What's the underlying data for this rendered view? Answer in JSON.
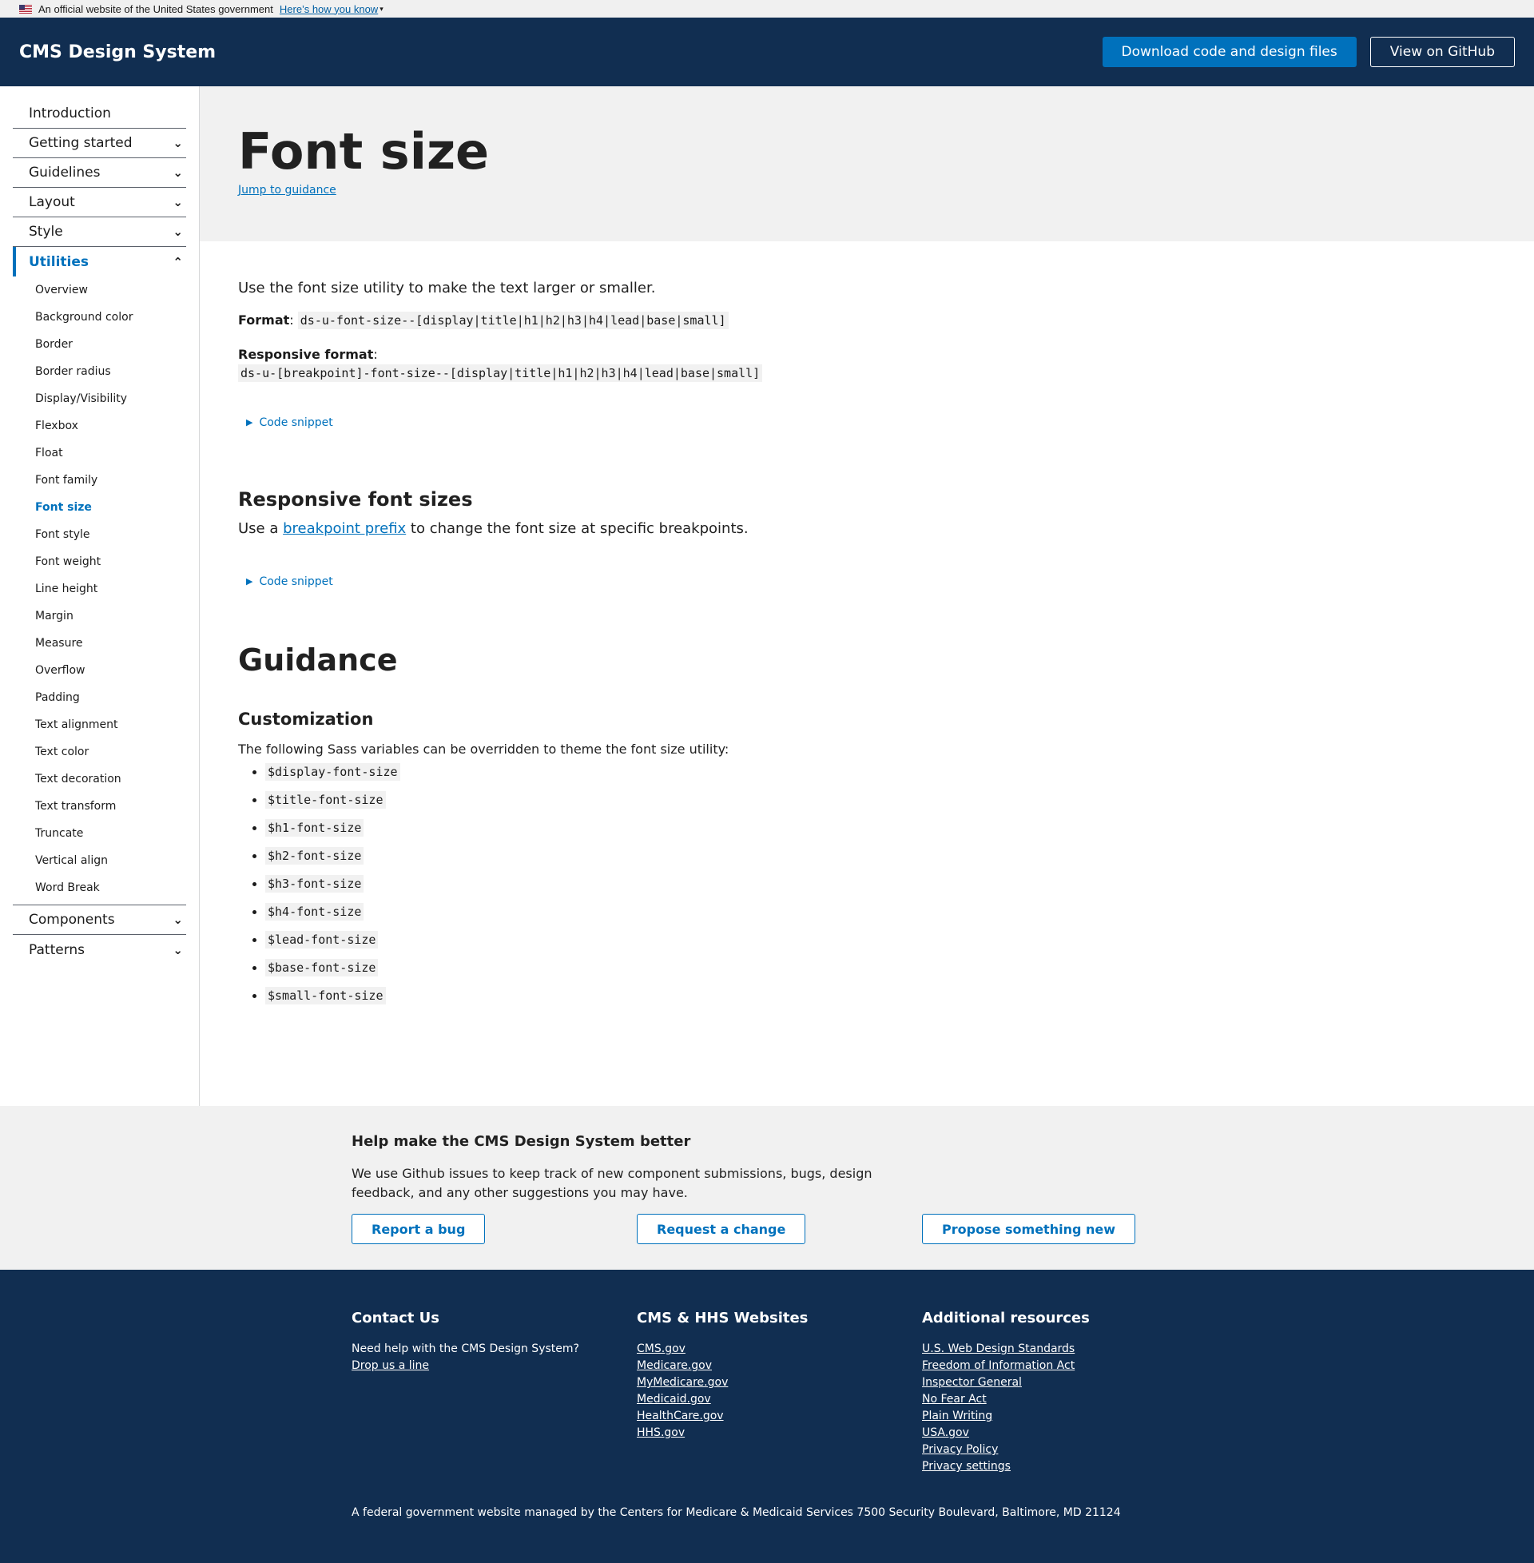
{
  "gov_banner": {
    "text": "An official website of the United States government",
    "link": "Here’s how you know"
  },
  "header": {
    "title": "CMS Design System",
    "download_label": "Download code and design files",
    "github_label": "View on GitHub"
  },
  "sidebar": {
    "top": [
      {
        "label": "Introduction"
      },
      {
        "label": "Getting started"
      },
      {
        "label": "Guidelines"
      },
      {
        "label": "Layout"
      },
      {
        "label": "Style"
      },
      {
        "label": "Utilities"
      }
    ],
    "utilities": [
      "Overview",
      "Background color",
      "Border",
      "Border radius",
      "Display/Visibility",
      "Flexbox",
      "Float",
      "Font family",
      "Font size",
      "Font style",
      "Font weight",
      "Line height",
      "Margin",
      "Measure",
      "Overflow",
      "Padding",
      "Text alignment",
      "Text color",
      "Text decoration",
      "Text transform",
      "Truncate",
      "Vertical align",
      "Word Break"
    ],
    "bottom": [
      {
        "label": "Components"
      },
      {
        "label": "Patterns"
      }
    ]
  },
  "page": {
    "title": "Font size",
    "jump_link": "Jump to guidance",
    "intro": "Use the font size utility to make the text larger or smaller.",
    "format_label": "Format",
    "format_code": "ds-u-font-size--[display|title|h1|h2|h3|h4|lead|base|small]",
    "responsive_format_label": "Responsive format",
    "responsive_format_code": "ds-u-[breakpoint]-font-size--[display|title|h1|h2|h3|h4|lead|base|small]",
    "code_snippet_label": "Code snippet",
    "responsive_heading": "Responsive font sizes",
    "responsive_text_before": "Use a ",
    "responsive_link": "breakpoint prefix",
    "responsive_text_after": " to change the font size at specific breakpoints.",
    "guidance_heading": "Guidance",
    "customization_heading": "Customization",
    "customization_text": "The following Sass variables can be overridden to theme the font size utility:",
    "variables": [
      "$display-font-size",
      "$title-font-size",
      "$h1-font-size",
      "$h2-font-size",
      "$h3-font-size",
      "$h4-font-size",
      "$lead-font-size",
      "$base-font-size",
      "$small-font-size"
    ]
  },
  "feedback": {
    "title": "Help make the CMS Design System better",
    "text": "We use Github issues to keep track of new component submissions, bugs, design feedback, and any other suggestions you may have.",
    "report_bug": "Report a bug",
    "request_change": "Request a change",
    "propose_new": "Propose something new"
  },
  "footer": {
    "contact": {
      "title": "Contact Us",
      "text": "Need help with the CMS Design System?",
      "link": "Drop us a line"
    },
    "websites": {
      "title": "CMS & HHS Websites",
      "links": [
        "CMS.gov",
        "Medicare.gov",
        "MyMedicare.gov",
        "Medicaid.gov",
        "HealthCare.gov",
        "HHS.gov"
      ]
    },
    "resources": {
      "title": "Additional resources",
      "links": [
        "U.S. Web Design Standards",
        "Freedom of Information Act",
        "Inspector General",
        "No Fear Act",
        "Plain Writing",
        "USA.gov",
        "Privacy Policy",
        "Privacy settings"
      ]
    },
    "note": "A federal government website managed by the Centers for Medicare & Medicaid Services 7500 Security Boulevard, Baltimore, MD 21124"
  },
  "colors": {
    "navy": "#112e51",
    "primary": "#0071bc",
    "gray_bg": "#f1f1f1"
  }
}
